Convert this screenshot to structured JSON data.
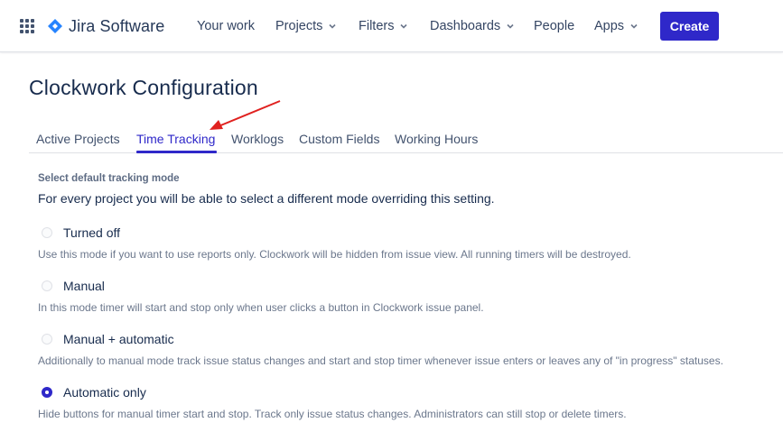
{
  "header": {
    "product_name": "Jira Software",
    "brand_color": "#2684ff",
    "accent_color": "#2f28c9",
    "nav": [
      {
        "label": "Your work",
        "has_dropdown": false
      },
      {
        "label": "Projects",
        "has_dropdown": true
      },
      {
        "label": "Filters",
        "has_dropdown": true
      },
      {
        "label": "Dashboards",
        "has_dropdown": true
      },
      {
        "label": "People",
        "has_dropdown": false
      },
      {
        "label": "Apps",
        "has_dropdown": true
      }
    ],
    "create_label": "Create",
    "icons": [
      "app-switcher-icon",
      "jira-logo-icon",
      "chevron-down-icon"
    ]
  },
  "page": {
    "title": "Clockwork Configuration",
    "tabs": [
      {
        "label": "Active Projects",
        "active": false
      },
      {
        "label": "Time Tracking",
        "active": true
      },
      {
        "label": "Worklogs",
        "active": false
      },
      {
        "label": "Custom Fields",
        "active": false
      },
      {
        "label": "Working Hours",
        "active": false
      }
    ],
    "annotation_color": "#e0211f"
  },
  "tracking": {
    "section_label": "Select default tracking mode",
    "section_desc": "For every project you will be able to select a different mode overriding this setting.",
    "options": [
      {
        "label": "Turned off",
        "desc": "Use this mode if you want to use reports only. Clockwork will be hidden from issue view. All running timers will be destroyed.",
        "selected": false
      },
      {
        "label": "Manual",
        "desc": "In this mode timer will start and stop only when user clicks a button in Clockwork issue panel.",
        "selected": false
      },
      {
        "label": "Manual + automatic",
        "desc": "Additionally to manual mode track issue status changes and start and stop timer whenever issue enters or leaves any of \"in progress\" statuses.",
        "selected": false
      },
      {
        "label": "Automatic only",
        "desc": "Hide buttons for manual timer start and stop. Track only issue status changes. Administrators can still stop or delete timers.",
        "selected": true
      }
    ]
  }
}
